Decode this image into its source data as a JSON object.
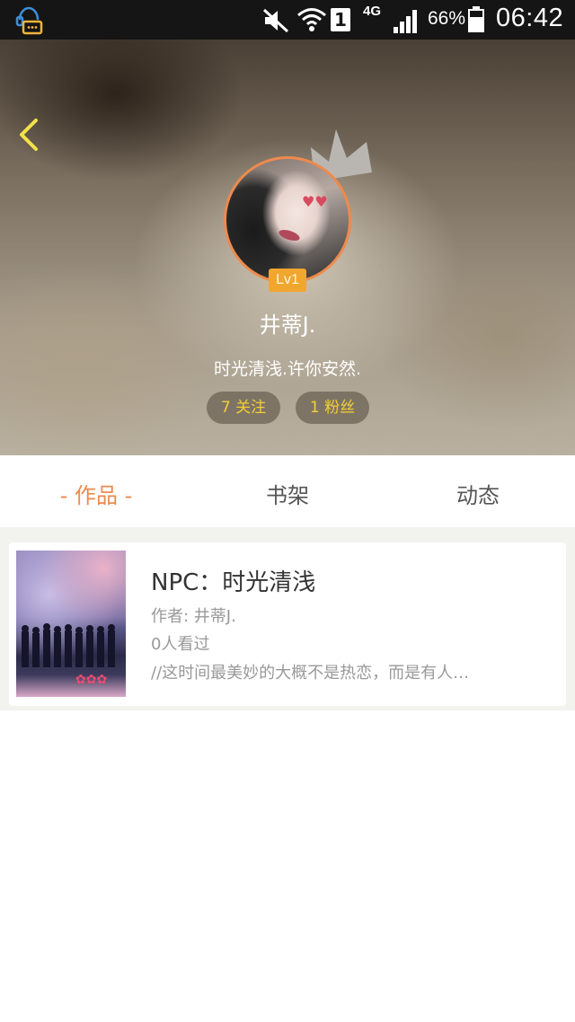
{
  "status_bar": {
    "net_label": "4G",
    "sim_label": "1",
    "battery": "66%",
    "time": "06:42",
    "icons": [
      "notification-chat-icon",
      "mute-icon",
      "wifi-icon",
      "signal-icon",
      "battery-icon"
    ]
  },
  "profile": {
    "level": "Lv1",
    "username": "井蒂J.",
    "bio": "时光清浅.许你安然.",
    "following": "7 关注",
    "followers": "1 粉丝"
  },
  "tabs": [
    {
      "label": "- 作品 -",
      "active": true
    },
    {
      "label": "书架",
      "active": false
    },
    {
      "label": "动态",
      "active": false
    }
  ],
  "books": [
    {
      "title": "NPC：时光清浅",
      "author": "作者: 井蒂J.",
      "views": "0人看过",
      "excerpt": "//这时间最美妙的大概不是热恋，而是有人…"
    }
  ],
  "colors": {
    "accent": "#ee8a4e",
    "pill_text": "#f4ce36",
    "level_badge": "#f1a62e",
    "back_arrow": "#f3e14a"
  }
}
